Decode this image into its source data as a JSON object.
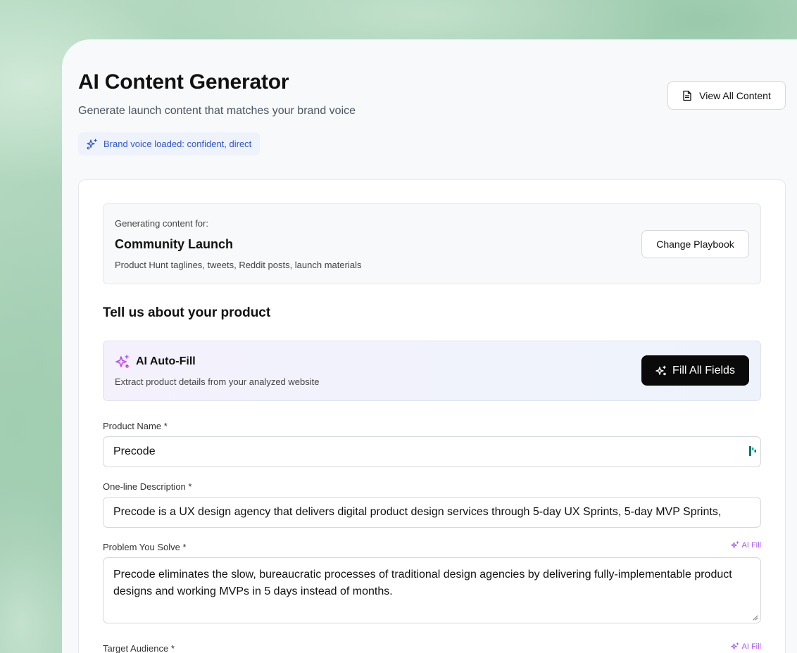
{
  "header": {
    "title": "AI Content Generator",
    "subtitle": "Generate launch content that matches your brand voice",
    "brand_voice": "Brand voice loaded: confident, direct",
    "view_all_label": "View All Content"
  },
  "playbook": {
    "eyebrow": "Generating content for:",
    "name": "Community Launch",
    "description": "Product Hunt taglines, tweets, Reddit posts, launch materials",
    "change_label": "Change Playbook"
  },
  "form": {
    "heading": "Tell us about your product",
    "autofill": {
      "title": "AI Auto-Fill",
      "description": "Extract product details from your analyzed website",
      "button_label": "Fill All Fields"
    },
    "ai_fill_label": "AI Fill",
    "fields": {
      "product_name": {
        "label": "Product Name *",
        "value": "Precode"
      },
      "description": {
        "label": "One-line Description *",
        "value": "Precode is a UX design agency that delivers digital product design services through 5-day UX Sprints, 5-day MVP Sprints,"
      },
      "problem": {
        "label": "Problem You Solve *",
        "value": "Precode eliminates the slow, bureaucratic processes of traditional design agencies by delivering fully-implementable product designs and working MVPs in 5 days instead of months."
      },
      "audience": {
        "label": "Target Audience *"
      }
    }
  },
  "colors": {
    "accent_purple": "#a855f7",
    "accent_blue": "#2f55c9",
    "primary_button": "#0a0a0a",
    "background_green": "#a9cfb6"
  },
  "icons": {
    "sparkles": "sparkles-icon",
    "document": "document-icon",
    "extension": "extension-icon"
  }
}
